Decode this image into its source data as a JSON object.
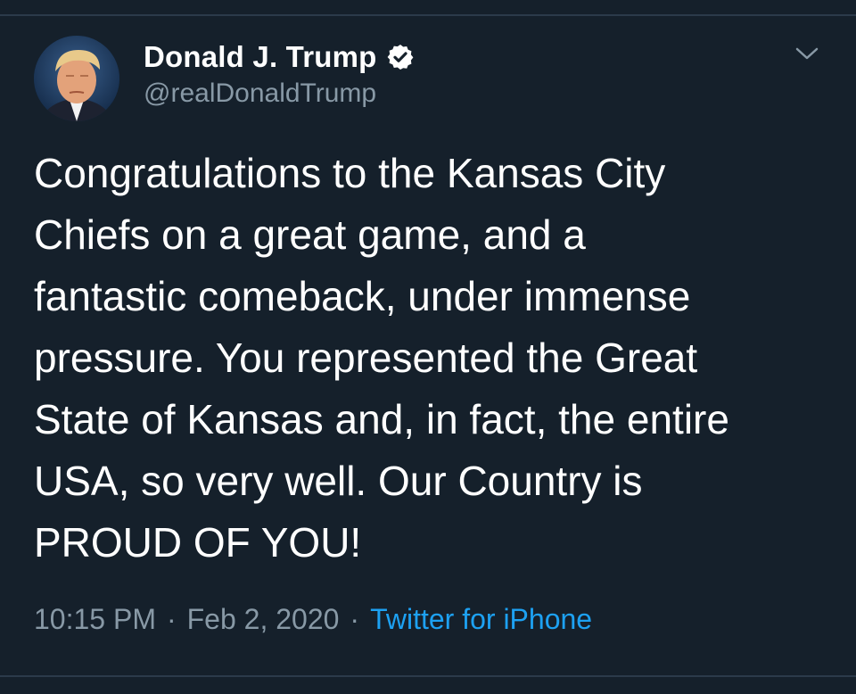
{
  "tweet": {
    "author": {
      "display_name": "Donald J. Trump",
      "handle": "@realDonaldTrump",
      "verified": true,
      "avatar_icon": "profile-photo"
    },
    "text": "Congratulations to the Kansas City\nChiefs on a great game, and a\nfantastic comeback, under immense\npressure. You represented the Great\nState of Kansas and, in fact, the entire\nUSA, so very well. Our Country is\nPROUD OF YOU!",
    "time": "10:15 PM",
    "separator": "·",
    "date": "Feb 2, 2020",
    "source": "Twitter for iPhone",
    "menu_icon": "chevron-down-icon"
  },
  "colors": {
    "background": "#15202b",
    "text": "#ffffff",
    "secondary_text": "#8899a6",
    "link": "#1da1f2",
    "divider": "#2b3a4a"
  }
}
